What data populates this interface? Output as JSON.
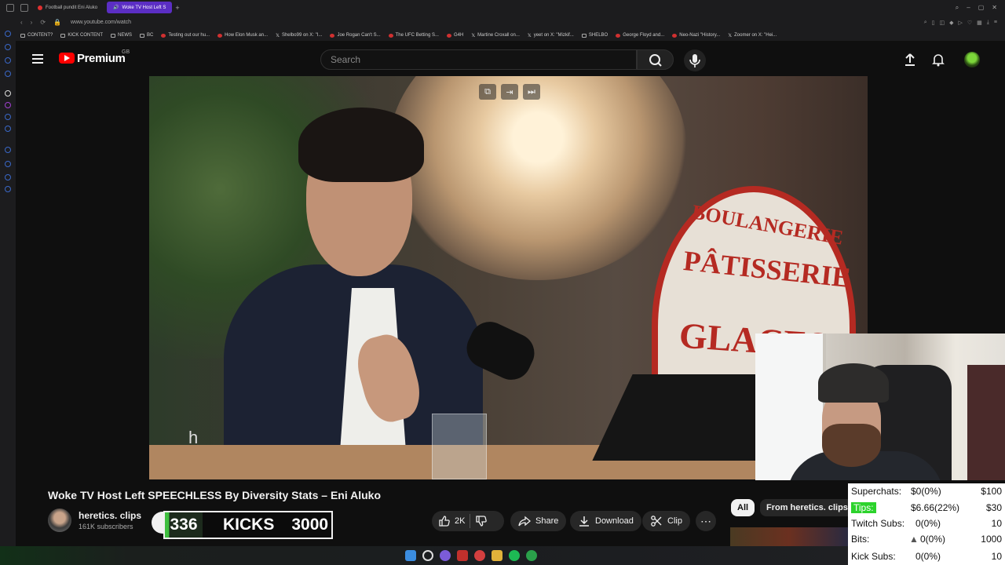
{
  "browser": {
    "tabs": [
      {
        "label": "Football pundit Eni Aluko",
        "active": false
      },
      {
        "label": "Woke TV Host Left S",
        "active": true
      }
    ],
    "url": "www.youtube.com/watch",
    "bookmarks": [
      "CONTENT?",
      "KICK CONTENT",
      "NEWS",
      "BC",
      "Testing out our hu...",
      "How Elon Musk an...",
      "Shelbo99 on X: \"I...",
      "Joe Rogan Can't S...",
      "The UFC Betting S...",
      "G4H",
      "Martine Croxall on...",
      "yeet on X: \"Mizkif...",
      "SHELBO",
      "George Floyd and...",
      "Neo-Nazi \"History...",
      "Zoomer on X: \"Hei..."
    ]
  },
  "youtube": {
    "brand": "Premium",
    "region": "GB",
    "search_placeholder": "Search"
  },
  "video": {
    "sign_line1": "BOULANGERIE",
    "sign_line2": "PÂTISSERIE",
    "sign_line3": "GLACES",
    "caption": "h",
    "title": "Woke TV Host Left SPEECHLESS By Diversity Stats – Eni Aluko"
  },
  "channel": {
    "name": "heretics. clips",
    "subscribers": "161K subscribers"
  },
  "kicks": {
    "count": "336",
    "label": "KICKS",
    "goal": "3000",
    "progress": 0.112
  },
  "actions": {
    "likes": "2K",
    "share": "Share",
    "download": "Download",
    "clip": "Clip"
  },
  "filters": {
    "all": "All",
    "from_channel": "From heretics. clips"
  },
  "stats": [
    {
      "label": "Superchats:",
      "value": "$0(0%)",
      "target": "$100"
    },
    {
      "label": "Tips:",
      "value": "$6.66(22%)",
      "target": "$30"
    },
    {
      "label": "Twitch Subs:",
      "value": "0(0%)",
      "target": "10"
    },
    {
      "label": "Bits:",
      "value": "0(0%)",
      "target": "1000"
    },
    {
      "label": "Kick Subs:",
      "value": "0(0%)",
      "target": "10"
    }
  ],
  "colors": {
    "yt_red": "#ff0000",
    "tab_active": "#5b2ec4",
    "tips_green": "#2cd32c",
    "kicks_green": "#3fbf3f"
  }
}
